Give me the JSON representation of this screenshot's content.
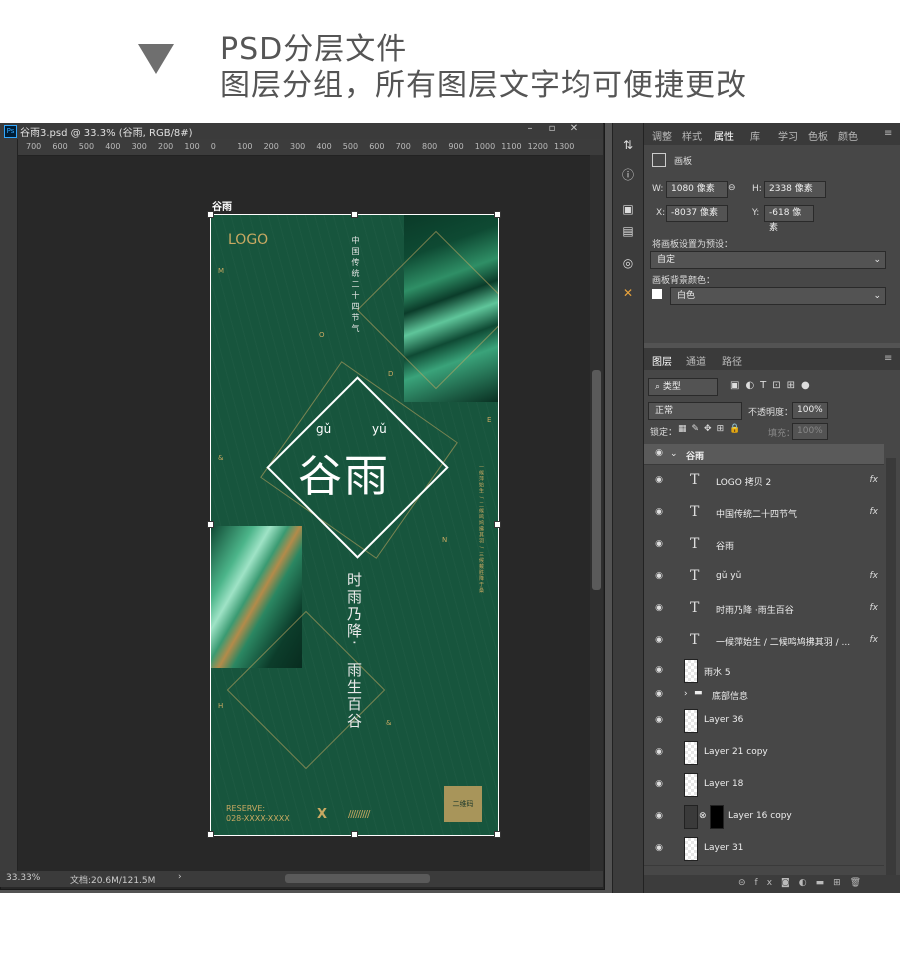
{
  "caption": {
    "line1": "PSD分层文件",
    "line2": "图层分组，所有图层文字均可便捷更改"
  },
  "document": {
    "title": "谷雨3.psd @ 33.3% (谷雨, RGB/8#)",
    "ps_badge": "Ps",
    "ruler_numbers": [
      "700",
      "600",
      "500",
      "400",
      "300",
      "200",
      "100",
      "0",
      "100",
      "200",
      "300",
      "400",
      "500",
      "600",
      "700",
      "800",
      "900",
      "1000",
      "1100",
      "1200",
      "1300"
    ],
    "artboard_label": "谷雨",
    "zoom": "33.33%",
    "doc_size": "文档:20.6M/121.5M"
  },
  "poster": {
    "logo": "LOGO",
    "vertical_small": "中国传统二十四节气",
    "pinyin_left": "gǔ",
    "pinyin_right": "yǔ",
    "main_title": "谷雨",
    "poem_col1": "时雨乃降·",
    "poem_col2": "雨生百谷",
    "side_vertical": "一候萍始生 / 二候鸣鸠拂其羽 / 三候戴胜降于桑",
    "letters": [
      "M",
      "O",
      "D",
      "E",
      "&",
      "N",
      "H",
      "&"
    ],
    "reserve_label": "RESERVE:",
    "reserve_phone": "028-XXXX-XXXX",
    "x_mark": "X",
    "slashes": "/////////",
    "qr_label": "二维码"
  },
  "properties_panel": {
    "tabs": [
      "调整",
      "样式",
      "属性",
      "库",
      "学习",
      "色板",
      "颜色"
    ],
    "active_tab": "属性",
    "section": "画板",
    "w_label": "W:",
    "w_value": "1080 像素",
    "h_label": "H:",
    "h_value": "2338 像素",
    "x_label": "X:",
    "x_value": "-8037 像素",
    "y_label": "Y:",
    "y_value": "-618 像素",
    "preset_label": "将画板设置为预设：",
    "preset_value": "自定",
    "bg_label": "画板背景颜色：",
    "bg_value": "白色"
  },
  "layers_panel": {
    "tabs": [
      "图层",
      "通道",
      "路径"
    ],
    "active_tab": "图层",
    "filter": "类型",
    "blend_mode": "正常",
    "opacity_label": "不透明度：",
    "opacity_value": "100%",
    "lock_label": "锁定：",
    "fill_label": "填充：",
    "fill_value": "100%",
    "group_name": "谷雨",
    "layers": [
      {
        "name": "LOGO 拷贝 2",
        "type": "text",
        "fx": "fx"
      },
      {
        "name": "中国传统二十四节气",
        "type": "text",
        "fx": "fx"
      },
      {
        "name": "谷雨",
        "type": "text",
        "fx": ""
      },
      {
        "name": "gǔ          yǔ",
        "type": "text",
        "fx": "fx"
      },
      {
        "name": "时雨乃降 ·雨生百谷",
        "type": "text",
        "fx": "fx"
      },
      {
        "name": "一候萍始生 / 二候鸣鸠拂其羽 / ...",
        "type": "text",
        "fx": "fx"
      },
      {
        "name": "雨水 5",
        "type": "smart",
        "fx": ""
      },
      {
        "name": "底部信息",
        "type": "folder",
        "fx": ""
      },
      {
        "name": "Layer 36",
        "type": "pixel",
        "fx": ""
      },
      {
        "name": "Layer 21 copy",
        "type": "pixel",
        "fx": ""
      },
      {
        "name": "Layer 18",
        "type": "pixel",
        "fx": ""
      },
      {
        "name": "Layer 16 copy",
        "type": "masked",
        "fx": ""
      },
      {
        "name": "Layer 31",
        "type": "pixel",
        "fx": ""
      }
    ]
  },
  "colors": {
    "poster_green": "#17553d",
    "gold": "#c9a962",
    "panel_bg": "#474747",
    "canvas_bg": "#282828"
  }
}
